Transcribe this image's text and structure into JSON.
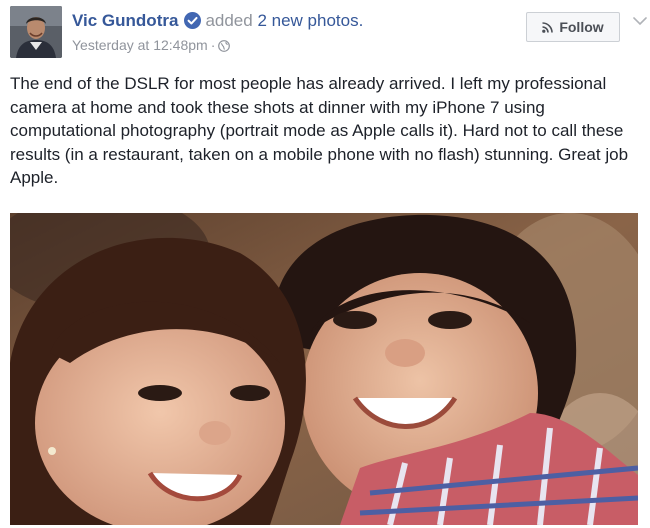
{
  "post": {
    "author": {
      "name": "Vic Gundotra",
      "verified_icon": "verified-badge-icon"
    },
    "action": {
      "prefix": "added",
      "link": "2 new photos."
    },
    "timestamp": "Yesterday at 12:48pm",
    "separator": "·",
    "privacy_icon": "globe-icon",
    "follow_label": "Follow",
    "message": "The end of the DSLR for most people has already arrived. I left my professional camera at home and took these shots at dinner with my iPhone 7 using computational photography (portrait mode as Apple calls it). Hard not to call these results (in a restaurant, taken on a mobile phone with no flash) stunning. Great job Apple.",
    "photo": {
      "subject": "two smiling children"
    }
  },
  "colors": {
    "link": "#365899",
    "meta": "#90949c",
    "text": "#1d2129",
    "verified": "#4267b2"
  }
}
